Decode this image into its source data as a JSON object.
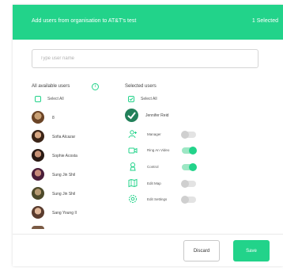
{
  "header": {
    "title": "Add users from organisation to AT&T's test",
    "selected_count": "1 Selected",
    "color": "#22d38a"
  },
  "search": {
    "placeholder": "Type user name"
  },
  "available": {
    "title": "All available users",
    "select_all": "Select All",
    "users": [
      {
        "name": "8"
      },
      {
        "name": "Sofia Alcazar"
      },
      {
        "name": "Sophie Acosta"
      },
      {
        "name": "Sung Jin Shil"
      },
      {
        "name": "Sung Jin Shil"
      },
      {
        "name": "Sang Young Il"
      }
    ]
  },
  "selected": {
    "title": "Selected users",
    "select_all": "Select All",
    "user": {
      "name": "Jennifer Reid"
    },
    "permissions": [
      {
        "label": "Manager",
        "icon": "manager-icon",
        "on": false
      },
      {
        "label": "Ring An Video",
        "icon": "video-icon",
        "on": true
      },
      {
        "label": "Control",
        "icon": "control-icon",
        "on": true
      },
      {
        "label": "Edit Map",
        "icon": "map-icon",
        "on": false
      },
      {
        "label": "Edit Settings",
        "icon": "settings-icon",
        "on": false
      }
    ]
  },
  "footer": {
    "discard": "Discard",
    "save": "Save"
  }
}
